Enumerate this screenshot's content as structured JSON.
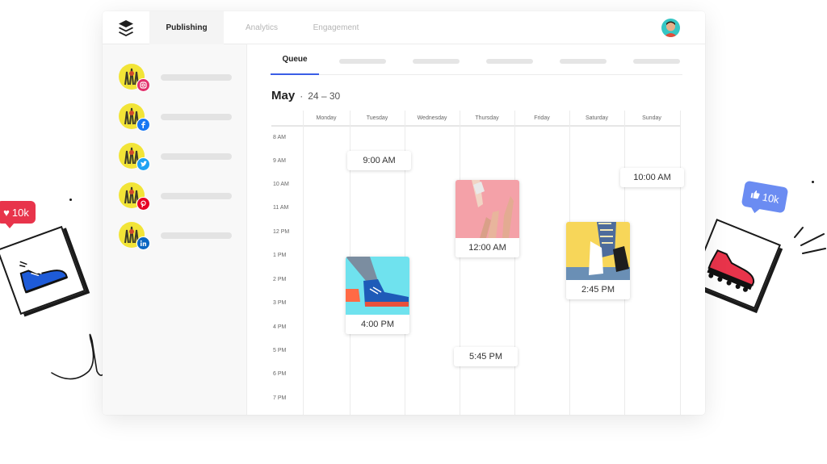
{
  "app": {
    "nav_tabs": [
      {
        "label": "Publishing",
        "active": true
      },
      {
        "label": "Analytics",
        "active": false
      },
      {
        "label": "Engagement",
        "active": false
      }
    ]
  },
  "sidebar": {
    "accounts": [
      {
        "network": "instagram",
        "icon": "instagram-icon",
        "color": "#e1306c"
      },
      {
        "network": "facebook",
        "icon": "facebook-icon",
        "color": "#1877f2"
      },
      {
        "network": "twitter",
        "icon": "twitter-icon",
        "color": "#1da1f2"
      },
      {
        "network": "pinterest",
        "icon": "pinterest-icon",
        "color": "#e60023"
      },
      {
        "network": "linkedin",
        "icon": "linkedin-icon",
        "color": "#0a66c2"
      }
    ]
  },
  "content": {
    "subtabs": {
      "active_label": "Queue"
    },
    "calendar": {
      "month": "May",
      "separator": "·",
      "range": "24 – 30",
      "days": [
        "Monday",
        "Tuesday",
        "Wednesday",
        "Thursday",
        "Friday",
        "Saturday",
        "Sunday"
      ],
      "hours": [
        "8 AM",
        "9 AM",
        "10 AM",
        "11 AM",
        "12 PM",
        "1 PM",
        "2 PM",
        "3 PM",
        "4 PM",
        "5 PM",
        "6 PM",
        "7 PM"
      ],
      "posts": [
        {
          "time": "9:00 AM",
          "day": "Tuesday",
          "type": "text"
        },
        {
          "time": "10:00 AM",
          "day": "Sunday",
          "type": "text"
        },
        {
          "time": "12:00 AM",
          "day": "Thursday",
          "type": "image"
        },
        {
          "time": "2:45 PM",
          "day": "Saturday",
          "type": "image"
        },
        {
          "time": "4:00 PM",
          "day": "Tuesday",
          "type": "image"
        },
        {
          "time": "5:45 PM",
          "day": "Thursday",
          "type": "text"
        }
      ]
    }
  },
  "decorations": {
    "like_badge": {
      "icon": "heart-icon",
      "count": "10k",
      "color": "#e8344b"
    },
    "thumb_badge": {
      "icon": "thumbs-up-icon",
      "count": "10k",
      "color": "#6b8cf2"
    }
  },
  "colors": {
    "accent": "#3a5ee6"
  }
}
